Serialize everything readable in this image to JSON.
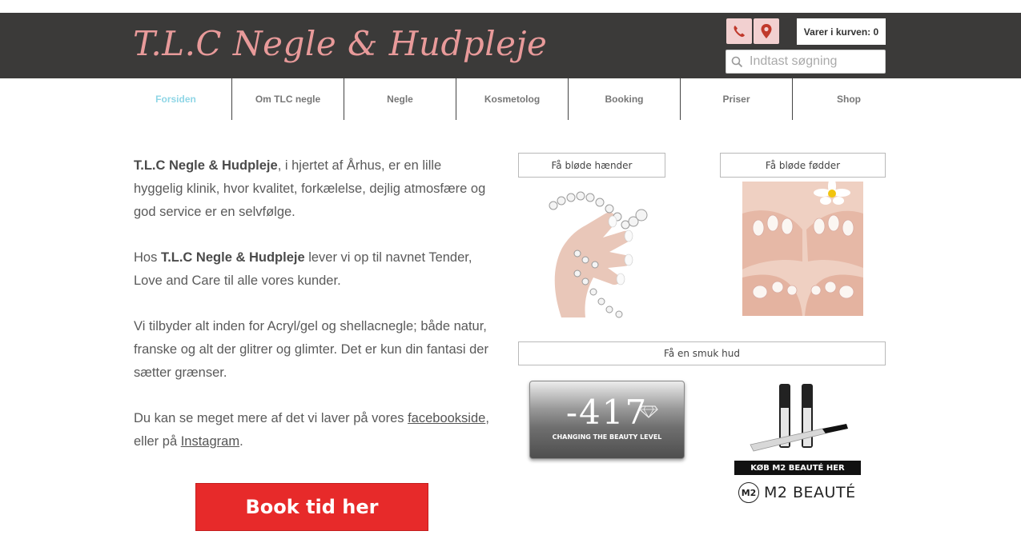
{
  "header": {
    "logo_text": "T.L.C Negle & Hudpleje",
    "cart_label": "Varer i kurven: 0",
    "search_placeholder": "Indtast søgning",
    "phone_icon": "phone-icon",
    "map_icon": "map-pin-icon"
  },
  "nav": {
    "items": [
      "Forsiden",
      "Om TLC negle",
      "Negle",
      "Kosmetolog",
      "Booking",
      "Priser",
      "Shop"
    ],
    "active": "Forsiden"
  },
  "content": {
    "p1_bold": "T.L.C Negle & Hudpleje",
    "p1_rest": ", i hjertet af Århus, er en lille hyggelig klinik, hvor kvalitet, forkælelse, dejlig atmosfære og god service er en selvfølge.",
    "p2_start": "Hos ",
    "p2_bold": "T.L.C Negle & Hudpleje",
    "p2_rest": " lever vi op til navnet Tender, Love and Care til alle vores kunder.",
    "p3": "Vi tilbyder alt inden for Acryl/gel og shellacnegle;  både natur, franske og alt der glitrer og glimter. Det er kun din fantasi der sætter grænser.",
    "p4_start": "Du kan se meget mere af det vi laver på vores  ",
    "p4_link1": "facebookside",
    "p4_mid": ", eller på ",
    "p4_link2": "Instagram",
    "p4_end": "."
  },
  "book_button": "Book tid her",
  "side": {
    "hands_label": "Få bløde hænder",
    "feet_label": "Få bløde fødder",
    "skin_label": "Få en smuk hud",
    "brand_417_number": "-417",
    "brand_417_tagline": "CHANGING THE BEAUTY LEVEL",
    "m2_banner": "KØB M2 BEAUTÉ HER",
    "m2_logo_mark": "M2",
    "m2_logo_text": "M2 BEAUTÉ"
  },
  "colors": {
    "header_bg": "#3b3a39",
    "logo": "#e89a9a",
    "nav_active": "#8fd6e6",
    "book_button": "#e72a2a"
  }
}
